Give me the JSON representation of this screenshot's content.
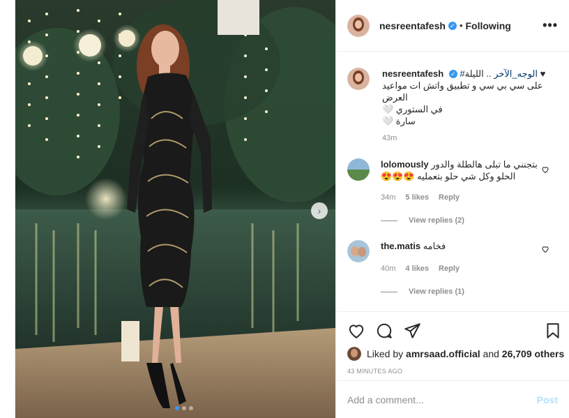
{
  "post": {
    "author": "nesreentafesh",
    "verified_mark": "✓",
    "separator": "•",
    "follow_status": "Following",
    "more_label": "•••"
  },
  "caption": {
    "username": "nesreentafesh",
    "line1_heart": "♥",
    "line1_hashtag": "#الوجه_الآخر",
    "line1_text": ".. الليلة",
    "line2": "على سي بي سي و تطبيق واتش ات مواعيد العرض",
    "line3": "في الستوري 🤍",
    "line4": "سارة 🤍",
    "time": "43m"
  },
  "comments": [
    {
      "username": "lolomously",
      "text": "بتجنني ما تبلى هالطلة والدور",
      "text2": "الحلو وكل شي حلو بتعمليه 😍😍😍",
      "time": "34m",
      "likes": "5 likes",
      "reply": "Reply",
      "view_replies": "View replies (2)"
    },
    {
      "username": "the.matis",
      "text": "فخامه",
      "time": "40m",
      "likes": "4 likes",
      "reply": "Reply",
      "view_replies": "View replies (1)"
    }
  ],
  "likes": {
    "prefix": "Liked by",
    "user": "amrsaad.official",
    "and": "and",
    "count": "26,709 others"
  },
  "timestamp": "43 MINUTES AGO",
  "comment_box": {
    "placeholder": "Add a comment...",
    "post_label": "Post"
  },
  "carousel": {
    "current": 1,
    "total": 3,
    "next_label": "›"
  },
  "colors": {
    "accent": "#3897f0",
    "link": "#00376b",
    "muted": "#8e8e8e",
    "post_disabled": "#b2dffc"
  }
}
